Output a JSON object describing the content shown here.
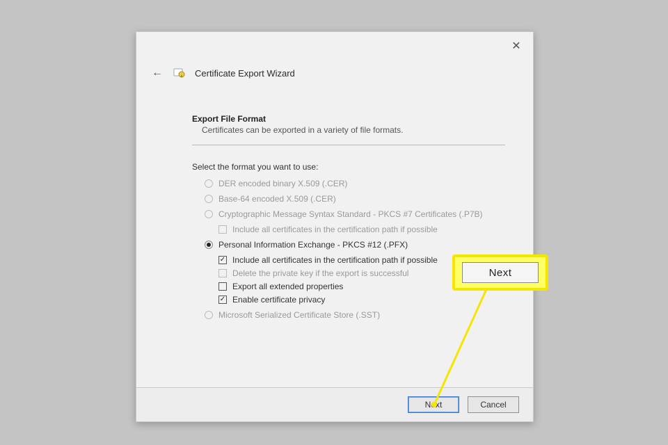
{
  "wizard": {
    "title": "Certificate Export Wizard"
  },
  "section": {
    "heading": "Export File Format",
    "sub": "Certificates can be exported in a variety of file formats."
  },
  "prompt": "Select the format you want to use:",
  "options": {
    "der": "DER encoded binary X.509 (.CER)",
    "base64": "Base-64 encoded X.509 (.CER)",
    "pkcs7": "Cryptographic Message Syntax Standard - PKCS #7 Certificates (.P7B)",
    "pkcs7_include": "Include all certificates in the certification path if possible",
    "pfx": "Personal Information Exchange - PKCS #12 (.PFX)",
    "pfx_include": "Include all certificates in the certification path if possible",
    "pfx_delete": "Delete the private key if the export is successful",
    "pfx_extended": "Export all extended properties",
    "pfx_privacy": "Enable certificate privacy",
    "sst": "Microsoft Serialized Certificate Store (.SST)"
  },
  "footer": {
    "next": "Next",
    "cancel": "Cancel"
  },
  "callout": {
    "label": "Next"
  }
}
